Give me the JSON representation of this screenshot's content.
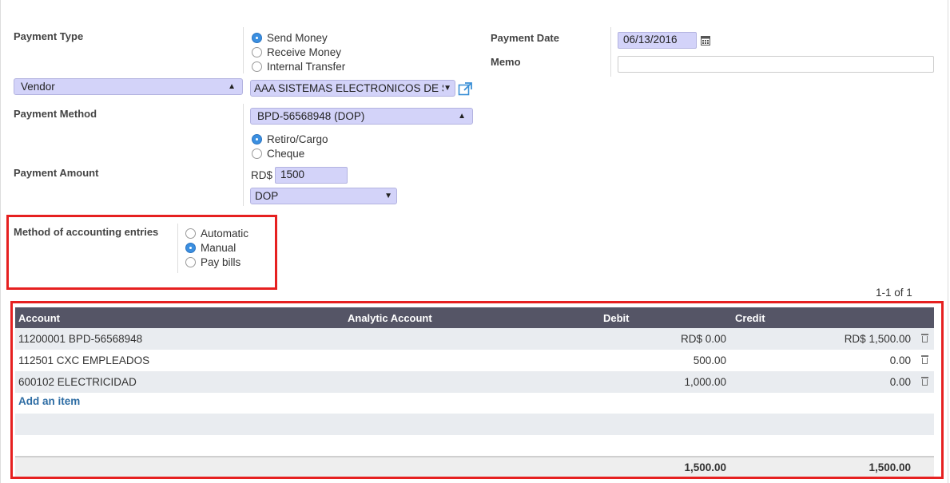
{
  "form": {
    "payment_type_label": "Payment Type",
    "payment_types": [
      "Send Money",
      "Receive Money",
      "Internal Transfer"
    ],
    "partner_type": "Vendor",
    "partner": "AAA SISTEMAS ELECTRONICOS DE SEG",
    "payment_method_label": "Payment Method",
    "journal": "BPD-56568948 (DOP)",
    "payment_methods": [
      "Retiro/Cargo",
      "Cheque"
    ],
    "payment_amount_label": "Payment Amount",
    "currency_symbol": "RD$",
    "amount": "1500",
    "currency": "DOP",
    "payment_date_label": "Payment Date",
    "payment_date": "06/13/2016",
    "memo_label": "Memo",
    "memo": "",
    "accounting_method_label": "Method of accounting entries",
    "accounting_methods": [
      "Automatic",
      "Manual",
      "Pay bills"
    ]
  },
  "pager": "1-1 of 1",
  "table": {
    "headers": [
      "Account",
      "Analytic Account",
      "Debit",
      "Credit"
    ],
    "rows": [
      {
        "account": "11200001 BPD-56568948",
        "analytic": "",
        "debit": "RD$ 0.00",
        "credit": "RD$ 1,500.00"
      },
      {
        "account": "112501 CXC EMPLEADOS",
        "analytic": "",
        "debit": "500.00",
        "credit": "0.00"
      },
      {
        "account": "600102 ELECTRICIDAD",
        "analytic": "",
        "debit": "1,000.00",
        "credit": "0.00"
      }
    ],
    "add_item": "Add an item",
    "total_debit": "1,500.00",
    "total_credit": "1,500.00"
  },
  "icons": [
    "calendar-icon",
    "external-link-icon",
    "trash-icon"
  ],
  "colors": {
    "field_bg": "#d3d3f9",
    "radio_on": "#3b8fe0",
    "header_bg": "#555566",
    "highlight": "#e62020",
    "link": "#2e6da4"
  }
}
